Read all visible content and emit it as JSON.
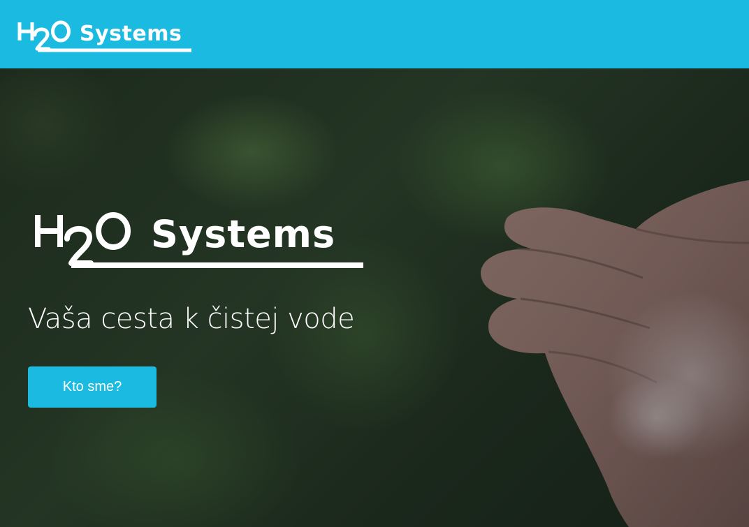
{
  "header": {
    "logo": "H2O Systems"
  },
  "hero": {
    "logo": "H2O Systems",
    "tagline": "Vaša cesta k čistej vode",
    "cta_label": "Kto sme?",
    "background_image": "hands-holding-water-icon"
  },
  "colors": {
    "brand": "#1bbae0",
    "text_on_dark": "#ffffff"
  }
}
